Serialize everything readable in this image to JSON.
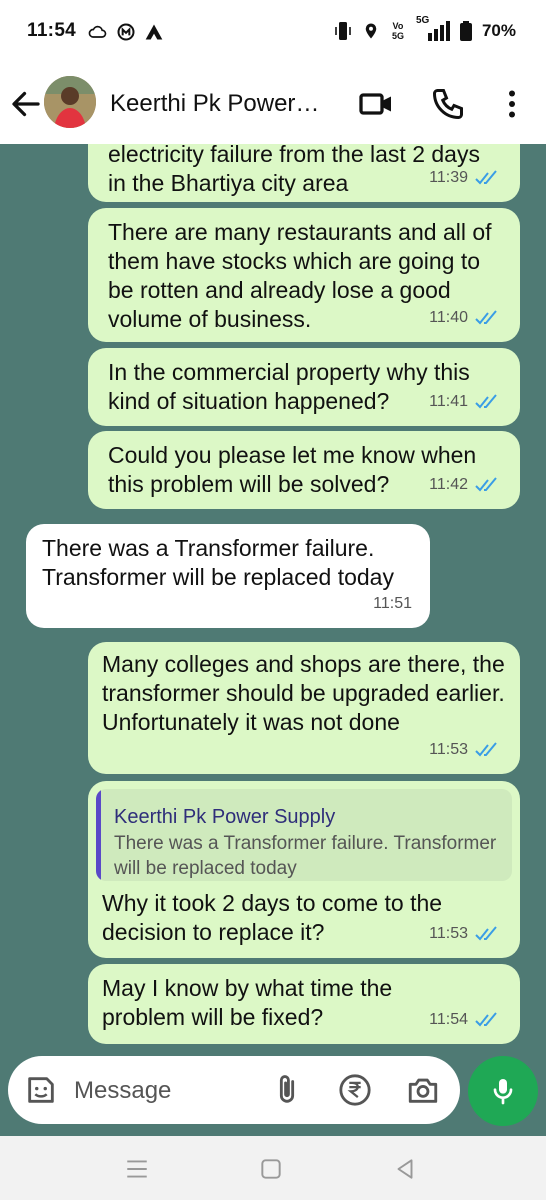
{
  "status_bar": {
    "time": "11:54",
    "left_icons": [
      "cloud-icon",
      "app-icon",
      "triangle-app-icon"
    ],
    "right_icons": [
      "vibrate-icon",
      "location-icon",
      "volte-icon",
      "5g-signal-icon",
      "battery-icon"
    ],
    "volte_label": "Vo 5G",
    "network_label": "5G",
    "battery_percent": "70%"
  },
  "header": {
    "contact_name": "Keerthi Pk Power…",
    "icons": [
      "back-arrow-icon",
      "video-call-icon",
      "phone-icon",
      "more-vert-icon"
    ]
  },
  "messages": [
    {
      "direction": "out",
      "text": "electricity failure from the last 2 days in the Bhartiya city area",
      "time": "11:39",
      "read": true
    },
    {
      "direction": "out",
      "text": "There are many restaurants and all of them have stocks which are going to be rotten and already lose a good volume of business.",
      "time": "11:40",
      "read": true
    },
    {
      "direction": "out",
      "text": "In the commercial property why this kind of situation happened?",
      "time": "11:41",
      "read": true
    },
    {
      "direction": "out",
      "text": "Could you please let me know when this problem will be solved?",
      "time": "11:42",
      "read": true
    },
    {
      "direction": "in",
      "text": "There was a Transformer failure. Transformer will be replaced today",
      "time": "11:51"
    },
    {
      "direction": "out",
      "text": "Many colleges and shops are there, the transformer should be upgraded earlier. Unfortunately it was not done",
      "time": "11:53",
      "read": true
    },
    {
      "direction": "out",
      "reply_to": {
        "name": "Keerthi Pk Power Supply",
        "text": "There was a Transformer failure. Transformer will be replaced today"
      },
      "text": "Why it took 2 days to come to the decision to replace it?",
      "time": "11:53",
      "read": true
    },
    {
      "direction": "out",
      "text": "May I know by what time the problem will be fixed?",
      "time": "11:54",
      "read": true
    }
  ],
  "composer": {
    "placeholder": "Message",
    "icons": [
      "sticker-icon",
      "attach-icon",
      "rupee-payment-icon",
      "camera-icon",
      "mic-icon"
    ]
  },
  "nav_bar": {
    "icons": [
      "recents-icon",
      "home-icon",
      "back-icon"
    ]
  },
  "colors": {
    "chat_background": "#4f7a74",
    "outgoing_bubble": "#dcf8c6",
    "incoming_bubble": "#ffffff",
    "read_tick": "#3a9de6",
    "mic_button": "#1fa855",
    "quote_bar": "#5a49c8"
  }
}
